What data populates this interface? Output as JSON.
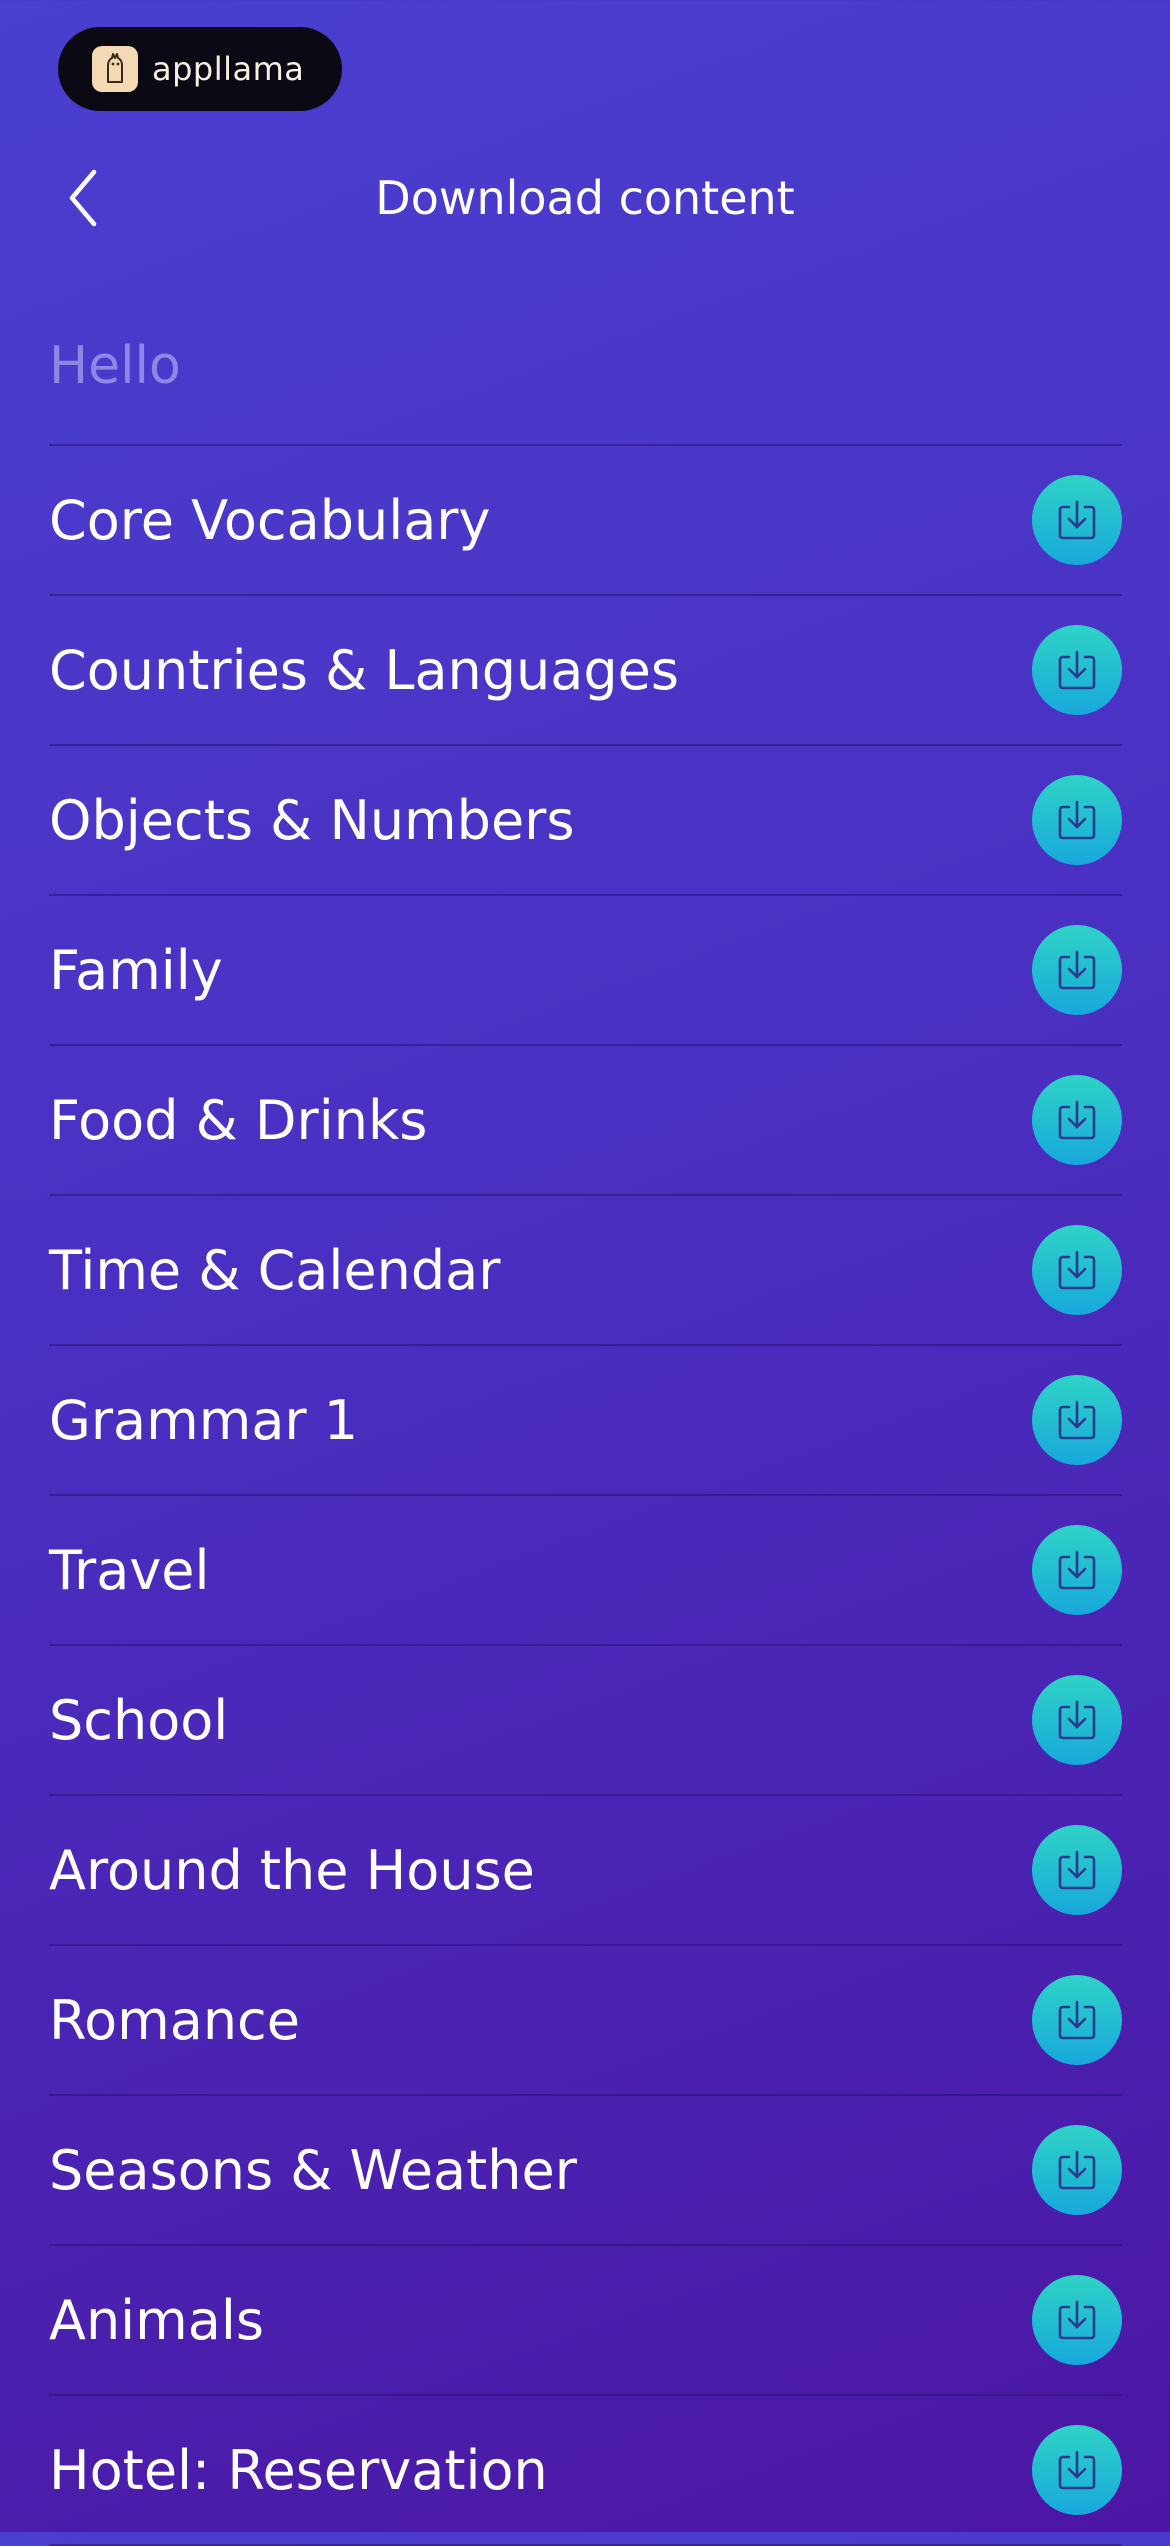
{
  "brand": {
    "name": "appllama",
    "logo_icon": "llama-logo-icon"
  },
  "header": {
    "back_icon": "chevron-left-icon",
    "title": "Download content"
  },
  "section": {
    "heading": "Hello"
  },
  "colors": {
    "background_top": "#4a3fcf",
    "background_bottom": "#4b16a3",
    "heading_muted": "#8f86e6",
    "download_button_top": "#2fd3c6",
    "download_button_bottom": "#18a8dc",
    "brand_pill": "#0b0a14"
  },
  "items": [
    {
      "label": "Core Vocabulary",
      "action_icon": "download-icon"
    },
    {
      "label": "Countries & Languages",
      "action_icon": "download-icon"
    },
    {
      "label": "Objects & Numbers",
      "action_icon": "download-icon"
    },
    {
      "label": "Family",
      "action_icon": "download-icon"
    },
    {
      "label": "Food & Drinks",
      "action_icon": "download-icon"
    },
    {
      "label": "Time & Calendar",
      "action_icon": "download-icon"
    },
    {
      "label": "Grammar 1",
      "action_icon": "download-icon"
    },
    {
      "label": "Travel",
      "action_icon": "download-icon"
    },
    {
      "label": "School",
      "action_icon": "download-icon"
    },
    {
      "label": "Around the House",
      "action_icon": "download-icon"
    },
    {
      "label": "Romance",
      "action_icon": "download-icon"
    },
    {
      "label": "Seasons & Weather",
      "action_icon": "download-icon"
    },
    {
      "label": "Animals",
      "action_icon": "download-icon"
    },
    {
      "label": "Hotel: Reservation",
      "action_icon": "download-icon"
    }
  ]
}
